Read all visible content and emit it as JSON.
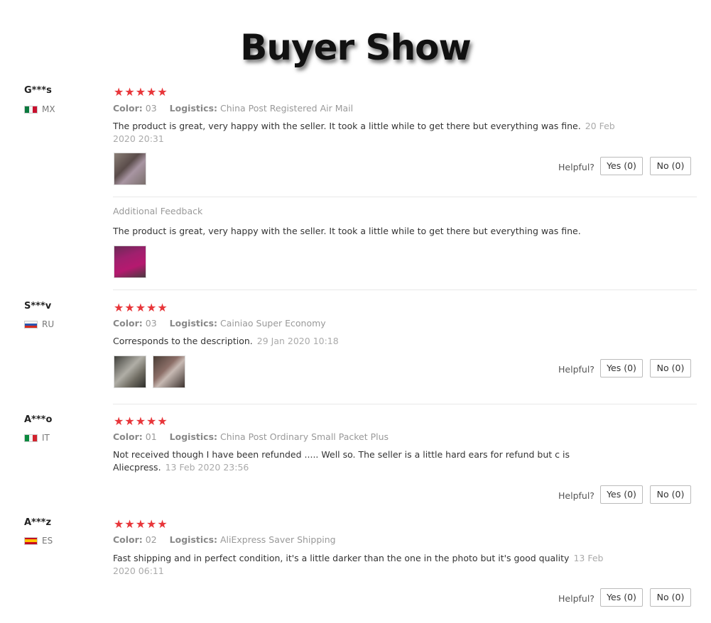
{
  "page": {
    "title": "Buyer Show"
  },
  "common": {
    "stars": "★★★★★",
    "color_label": "Color:",
    "logistics_label": "Logistics:",
    "helpful_label": "Helpful?",
    "additional_feedback_label": "Additional Feedback"
  },
  "reviews": [
    {
      "user": "G***s",
      "country_code": "MX",
      "rating": 5,
      "color": "03",
      "logistics": "China Post Registered Air Mail",
      "text": "The product is great, very happy with the seller. It took a little while to get there but everything was fine.",
      "date": "20 Feb 2020 20:31",
      "yes": "Yes (0)",
      "no": "No (0)",
      "additional": {
        "text": "The product is great, very happy with the seller. It took a little while to get there but everything was fine."
      }
    },
    {
      "user": "S***v",
      "country_code": "RU",
      "rating": 5,
      "color": "03",
      "logistics": "Cainiao Super Economy",
      "text": "Corresponds to the description.",
      "date": "29 Jan 2020 10:18",
      "yes": "Yes (0)",
      "no": "No (0)"
    },
    {
      "user": "A***o",
      "country_code": "IT",
      "rating": 5,
      "color": "01",
      "logistics": "China Post Ordinary Small Packet Plus",
      "text": "Not received though I have been refunded ..... Well so. The seller is a little hard ears for refund but c is Aliecpress.",
      "date": "13 Feb 2020 23:56",
      "yes": "Yes (0)",
      "no": "No (0)"
    },
    {
      "user": "A***z",
      "country_code": "ES",
      "rating": 5,
      "color": "02",
      "logistics": "AliExpress Saver Shipping",
      "text": "Fast shipping and in perfect condition, it's a little darker than the one in the photo but it's good quality",
      "date": "13 Feb 2020 06:11",
      "yes": "Yes (0)",
      "no": "No (0)"
    }
  ],
  "colors": {
    "star": "#e8363a",
    "muted": "#999999",
    "divider": "#e8e8e8"
  }
}
